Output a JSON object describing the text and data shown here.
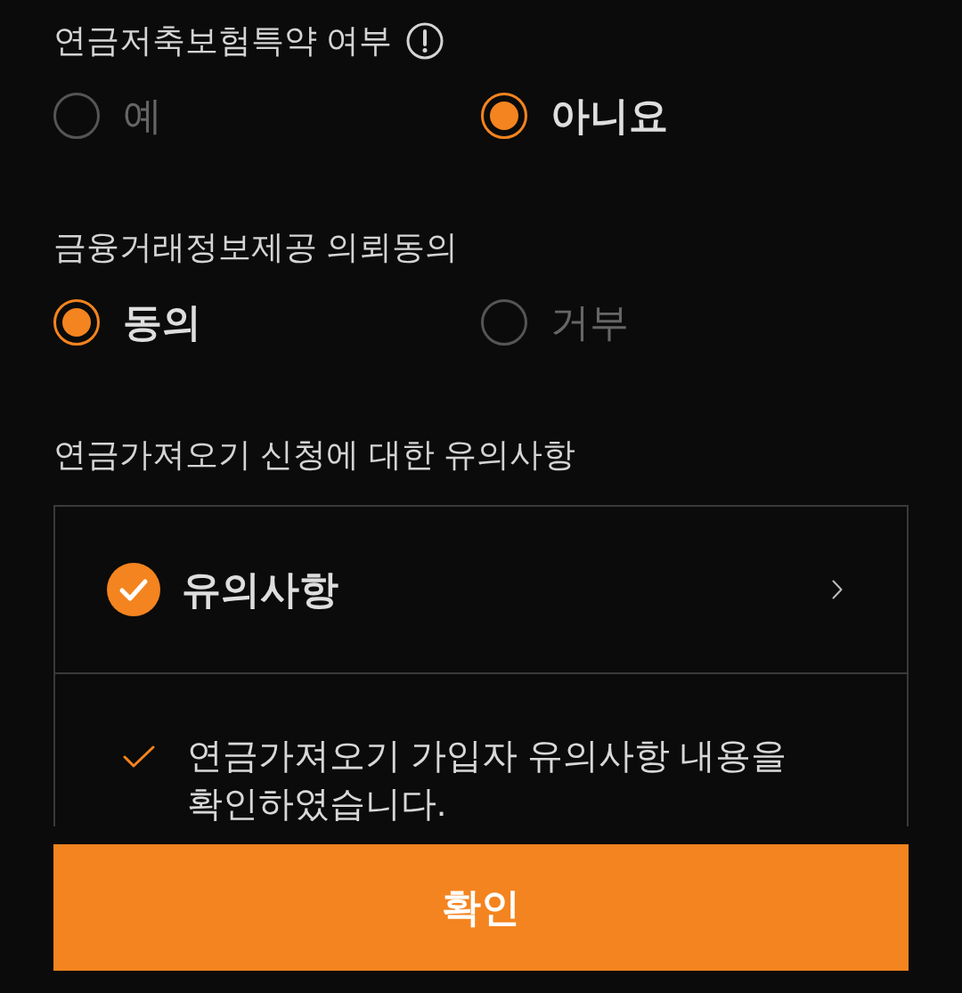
{
  "sections": [
    {
      "label": "연금저축보험특약 여부",
      "info": true,
      "options": [
        {
          "label": "예",
          "selected": false
        },
        {
          "label": "아니요",
          "selected": true
        }
      ]
    },
    {
      "label": "금융거래정보제공 의뢰동의",
      "info": false,
      "options": [
        {
          "label": "동의",
          "selected": true
        },
        {
          "label": "거부",
          "selected": false
        }
      ]
    }
  ],
  "notice": {
    "label": "연금가져오기 신청에 대한 유의사항",
    "header": {
      "title": "유의사항",
      "checked": true
    },
    "items": [
      {
        "text": "연금가져오기 가입자 유의사항 내용을 확인하였습니다.",
        "checked": true
      }
    ]
  },
  "confirm_button": "확인"
}
